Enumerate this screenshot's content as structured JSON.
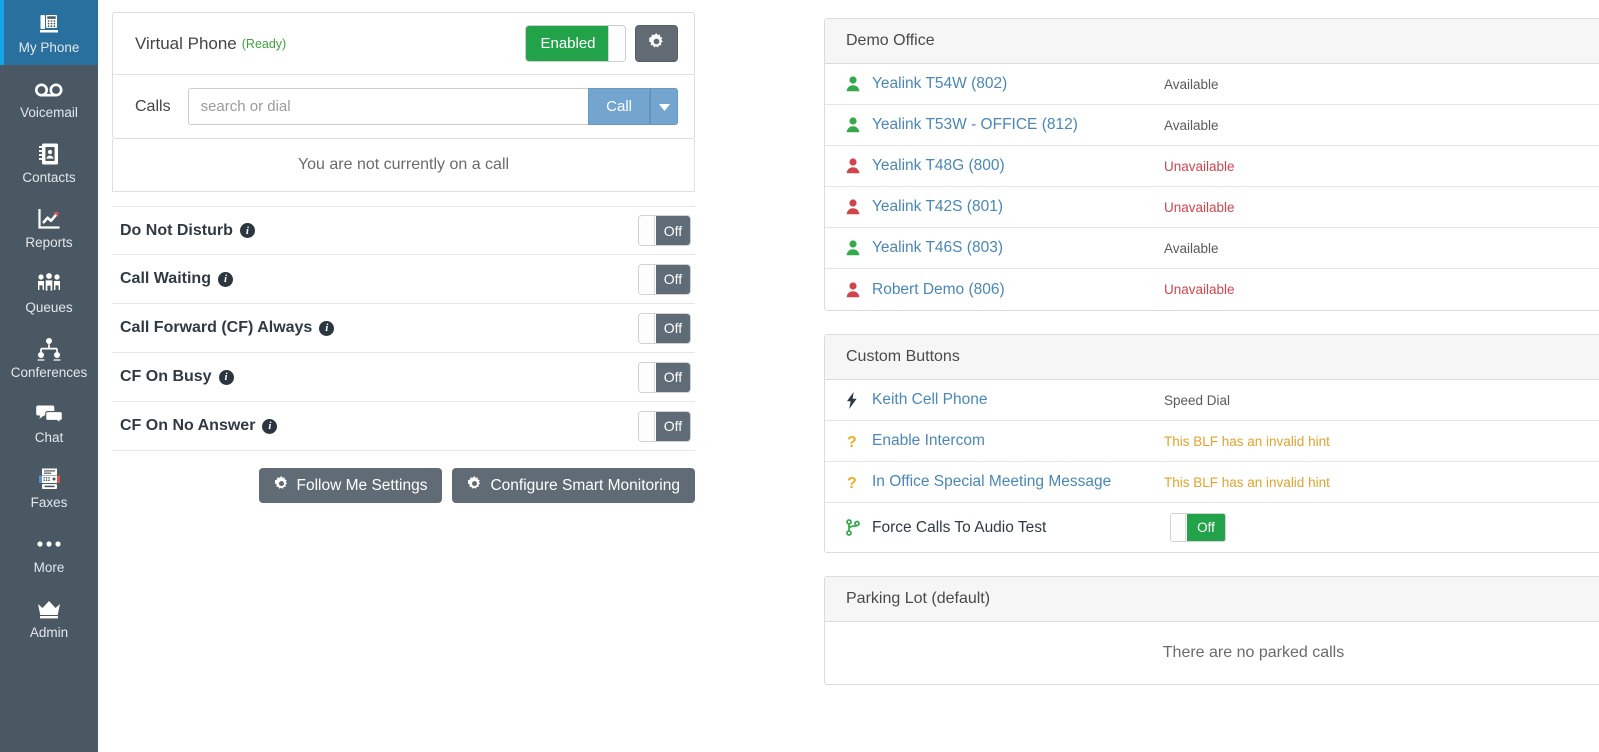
{
  "sidebar": {
    "items": [
      {
        "label": "My Phone",
        "icon": "desk-phone-icon",
        "active": true
      },
      {
        "label": "Voicemail",
        "icon": "voicemail-icon",
        "active": false
      },
      {
        "label": "Contacts",
        "icon": "contacts-book-icon",
        "active": false
      },
      {
        "label": "Reports",
        "icon": "chart-line-icon",
        "active": false
      },
      {
        "label": "Queues",
        "icon": "users-group-icon",
        "active": false
      },
      {
        "label": "Conferences",
        "icon": "sitemap-icon",
        "active": false
      },
      {
        "label": "Chat",
        "icon": "comments-icon",
        "active": false
      },
      {
        "label": "Faxes",
        "icon": "fax-machine-icon",
        "active": false
      },
      {
        "label": "More",
        "icon": "ellipsis-icon",
        "active": false
      },
      {
        "label": "Admin",
        "icon": "crown-icon",
        "active": false
      }
    ]
  },
  "virtual_phone": {
    "title": "Virtual Phone",
    "status": "(Ready)",
    "toggle_label": "Enabled",
    "settings_icon": "gear-icon",
    "calls_label": "Calls",
    "dial_placeholder": "search or dial",
    "dial_value": "",
    "call_button": "Call",
    "call_dropdown_icon": "caret-down-icon",
    "no_call_message": "You are not currently on a call"
  },
  "feature_toggles": [
    {
      "label": "Do Not Disturb",
      "state": "Off"
    },
    {
      "label": "Call Waiting",
      "state": "Off"
    },
    {
      "label": "Call Forward (CF) Always",
      "state": "Off"
    },
    {
      "label": "CF On Busy",
      "state": "Off"
    },
    {
      "label": "CF On No Answer",
      "state": "Off"
    }
  ],
  "action_buttons": [
    {
      "label": "Follow Me Settings",
      "icon": "gear-icon"
    },
    {
      "label": "Configure Smart Monitoring",
      "icon": "gear-icon"
    }
  ],
  "demo_office": {
    "title": "Demo Office",
    "rows": [
      {
        "name": "Yealink T54W (802)",
        "status": "Available",
        "presence": "available"
      },
      {
        "name": "Yealink T53W - OFFICE (812)",
        "status": "Available",
        "presence": "available"
      },
      {
        "name": "Yealink T48G (800)",
        "status": "Unavailable",
        "presence": "unavailable"
      },
      {
        "name": "Yealink T42S (801)",
        "status": "Unavailable",
        "presence": "unavailable"
      },
      {
        "name": "Yealink T46S (803)",
        "status": "Available",
        "presence": "available"
      },
      {
        "name": "Robert Demo (806)",
        "status": "Unavailable",
        "presence": "unavailable"
      }
    ]
  },
  "custom_buttons": {
    "title": "Custom Buttons",
    "rows": [
      {
        "name": "Keith Cell Phone",
        "status": "Speed Dial",
        "icon": "bolt-icon",
        "kind": "text"
      },
      {
        "name": "Enable Intercom",
        "status": "This BLF has an invalid hint",
        "icon": "question-mark-icon",
        "kind": "warn"
      },
      {
        "name": "In Office Special Meeting Message",
        "status": "This BLF has an invalid hint",
        "icon": "question-mark-icon",
        "kind": "warn"
      },
      {
        "name": "Force Calls To Audio Test",
        "status": "Off",
        "icon": "code-branch-icon",
        "kind": "toggle"
      }
    ]
  },
  "parking_lot": {
    "title": "Parking Lot (default)",
    "empty_message": "There are no parked calls"
  },
  "colors": {
    "sidebar_bg": "#4a5864",
    "sidebar_active": "#2a709e",
    "sidebar_accent": "#15a4e8",
    "green": "#22a34a",
    "link_blue": "#4a87b8",
    "call_blue": "#73a5ce",
    "red": "#d0454c",
    "amber": "#e0a32e",
    "dark_gray": "#5f6b77"
  }
}
